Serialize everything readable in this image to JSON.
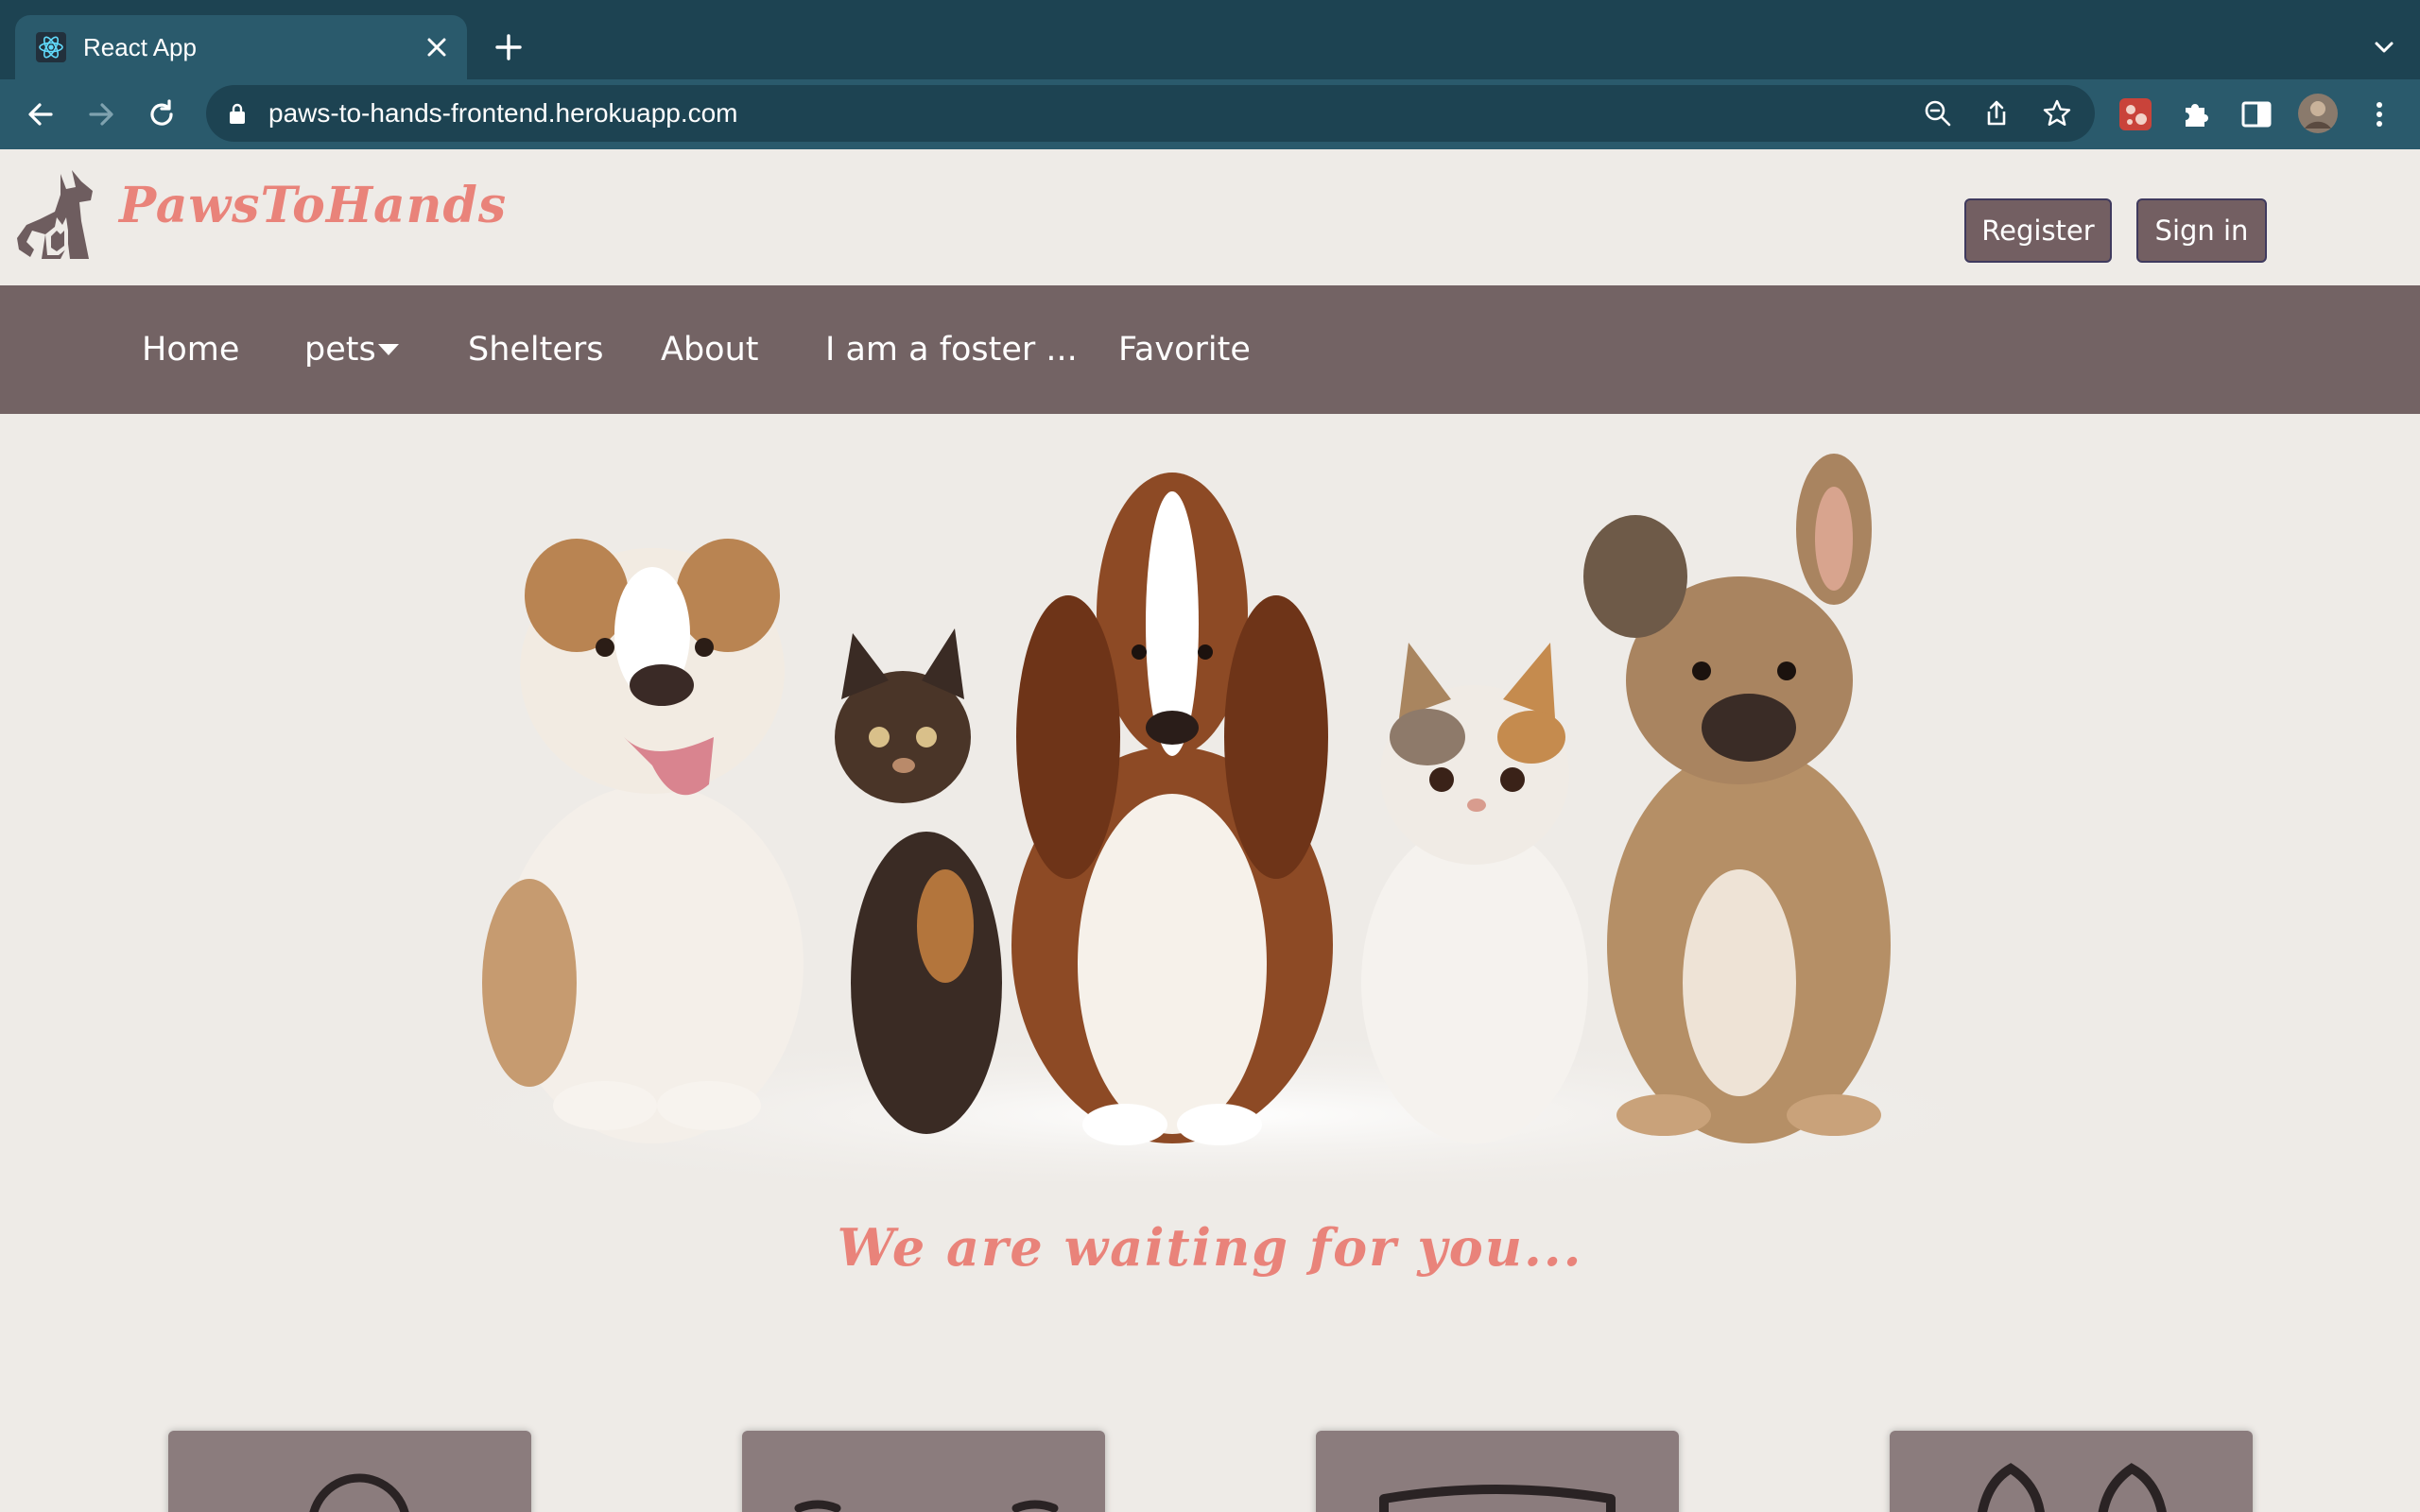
{
  "browser": {
    "tab_title": "React App",
    "url": "paws-to-hands-frontend.herokuapp.com"
  },
  "header": {
    "brand": "PawsToHands",
    "register_label": "Register",
    "signin_label": "Sign in"
  },
  "nav": {
    "items": [
      {
        "label": "Home"
      },
      {
        "label": "pets"
      },
      {
        "label": "Shelters"
      },
      {
        "label": "About"
      },
      {
        "label": "I am a foster ..."
      },
      {
        "label": "Favorite"
      }
    ]
  },
  "hero": {
    "image_alt": "dogs-and-cats-group-photo",
    "tagline": "We are waiting for you..."
  },
  "cards": [
    {
      "icon": "round-pet-icon"
    },
    {
      "icon": "cat-whiskers-icon"
    },
    {
      "icon": "cat-ears-icon"
    },
    {
      "icon": "dog-ears-icon"
    }
  ],
  "colors": {
    "brand_salmon": "#e9837a",
    "nav_bg": "#736364",
    "button_bg": "#735f62",
    "page_bg": "#eeebe7",
    "card_bg": "#8b7c7d",
    "chrome_dark": "#1d4352",
    "chrome_light": "#2a5a6c"
  }
}
